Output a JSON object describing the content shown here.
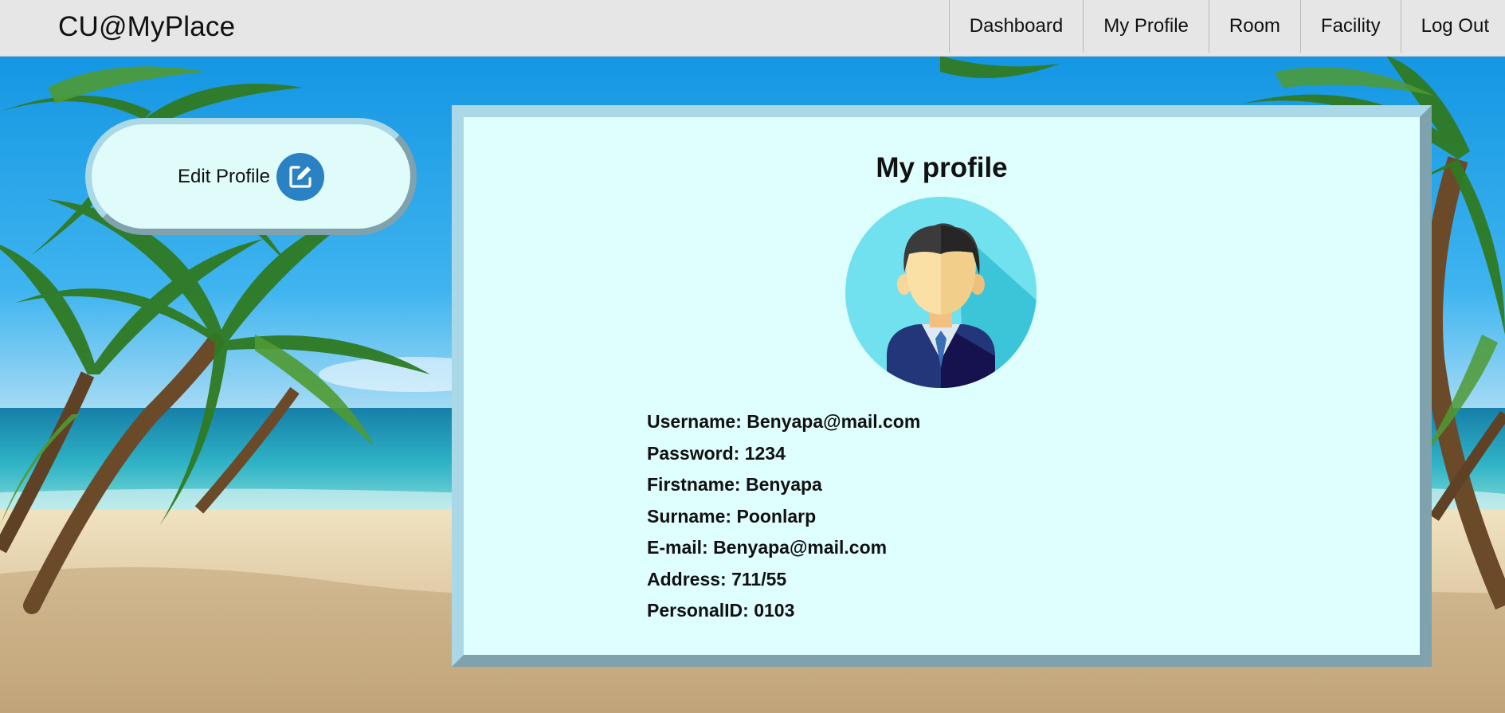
{
  "app": {
    "brand": "CU@MyPlace"
  },
  "nav": {
    "items": [
      {
        "label": "Dashboard"
      },
      {
        "label": "My Profile"
      },
      {
        "label": "Room"
      },
      {
        "label": "Facility"
      },
      {
        "label": "Log Out"
      }
    ]
  },
  "sidebar": {
    "edit_profile_label": "Edit Profile",
    "edit_icon": "edit-square-icon"
  },
  "profile": {
    "title": "My profile",
    "avatar": "person-avatar",
    "fields": [
      {
        "text": "Username: Benyapa@mail.com"
      },
      {
        "text": "Password: 1234"
      },
      {
        "text": "Firstname: Benyapa"
      },
      {
        "text": "Surname: Poonlarp"
      },
      {
        "text": "E-mail: Benyapa@mail.com"
      },
      {
        "text": "Address: 711/55"
      },
      {
        "text": "PersonalID: 0103"
      }
    ]
  },
  "colors": {
    "nav_bg": "#e6e6e6",
    "card_bg": "#dffefe",
    "accent": "#2a82c4",
    "card_border_light": "#aad8e6",
    "card_border_dark": "#7fa2ad"
  }
}
